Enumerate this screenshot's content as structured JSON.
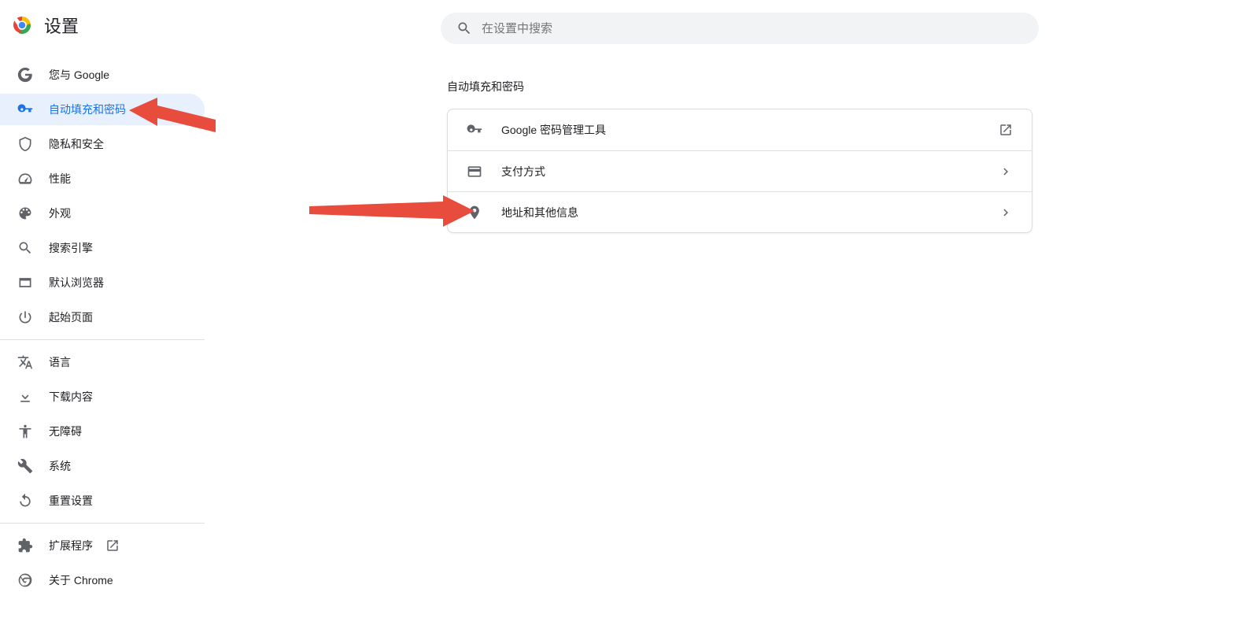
{
  "header": {
    "title": "设置"
  },
  "search": {
    "placeholder": "在设置中搜索"
  },
  "sidebar": {
    "items": [
      {
        "label": "您与 Google"
      },
      {
        "label": "自动填充和密码"
      },
      {
        "label": "隐私和安全"
      },
      {
        "label": "性能"
      },
      {
        "label": "外观"
      },
      {
        "label": "搜索引擎"
      },
      {
        "label": "默认浏览器"
      },
      {
        "label": "起始页面"
      },
      {
        "label": "语言"
      },
      {
        "label": "下载内容"
      },
      {
        "label": "无障碍"
      },
      {
        "label": "系统"
      },
      {
        "label": "重置设置"
      },
      {
        "label": "扩展程序"
      },
      {
        "label": "关于 Chrome"
      }
    ]
  },
  "main": {
    "section_title": "自动填充和密码",
    "rows": [
      {
        "label": "Google 密码管理工具"
      },
      {
        "label": "支付方式"
      },
      {
        "label": "地址和其他信息"
      }
    ]
  }
}
